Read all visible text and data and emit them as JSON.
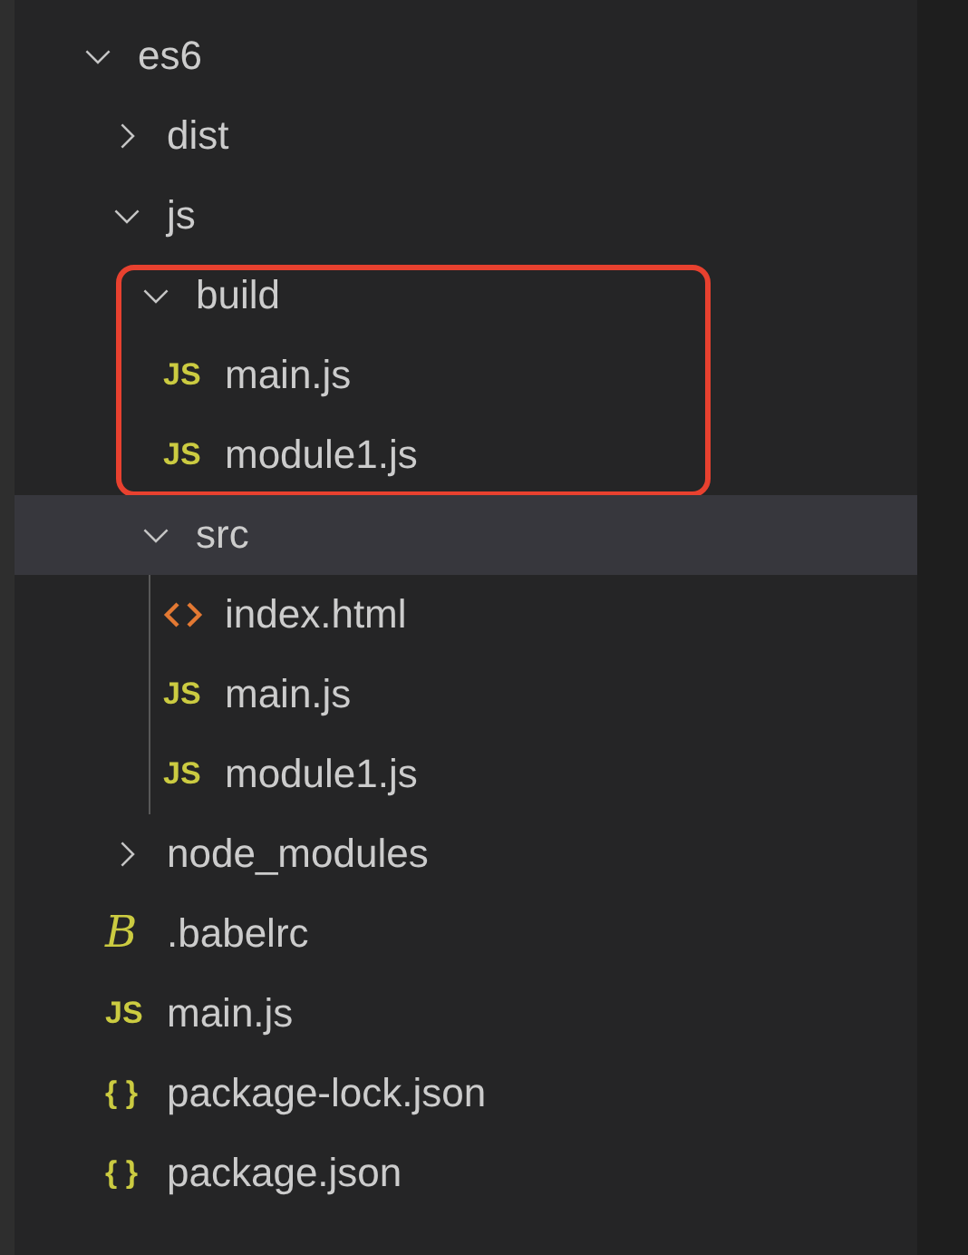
{
  "tree": [
    {
      "name": "es6",
      "kind": "folder",
      "expanded": true,
      "selected": false,
      "children": [
        {
          "name": "dist",
          "kind": "folder",
          "expanded": false,
          "selected": false
        },
        {
          "name": "js",
          "kind": "folder",
          "expanded": true,
          "selected": false,
          "children": [
            {
              "name": "build",
              "kind": "folder",
              "expanded": true,
              "selected": false,
              "annotated": true,
              "children": [
                {
                  "name": "main.js",
                  "kind": "js",
                  "icon": "JS",
                  "selected": false
                },
                {
                  "name": "module1.js",
                  "kind": "js",
                  "icon": "JS",
                  "selected": false
                }
              ]
            },
            {
              "name": "src",
              "kind": "folder",
              "expanded": true,
              "selected": true,
              "children": [
                {
                  "name": "index.html",
                  "kind": "html",
                  "selected": false
                },
                {
                  "name": "main.js",
                  "kind": "js",
                  "icon": "JS",
                  "selected": false
                },
                {
                  "name": "module1.js",
                  "kind": "js",
                  "icon": "JS",
                  "selected": false
                }
              ]
            }
          ]
        },
        {
          "name": "node_modules",
          "kind": "folder",
          "expanded": false,
          "selected": false
        },
        {
          "name": ".babelrc",
          "kind": "babel",
          "icon": "B",
          "selected": false
        },
        {
          "name": "main.js",
          "kind": "js",
          "icon": "JS",
          "selected": false
        },
        {
          "name": "package-lock.json",
          "kind": "json",
          "icon": "{ }",
          "selected": false
        },
        {
          "name": "package.json",
          "kind": "json",
          "icon": "{ }",
          "selected": false
        }
      ]
    }
  ]
}
